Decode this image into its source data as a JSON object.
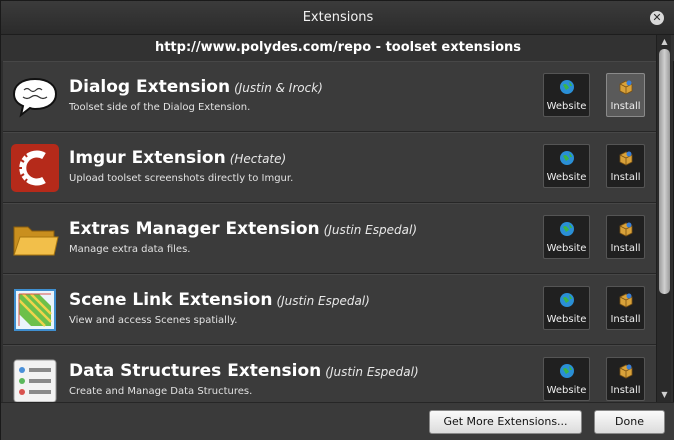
{
  "window": {
    "title": "Extensions"
  },
  "repo": {
    "header": "http://www.polydes.com/repo - toolset extensions"
  },
  "extensions": [
    {
      "name": "Dialog Extension",
      "author": "(Justin & Irock)",
      "description": "Toolset side of the Dialog Extension.",
      "icon": "speech-bubble-icon",
      "website_label": "Website",
      "install_label": "Install"
    },
    {
      "name": "Imgur Extension",
      "author": "(Hectate)",
      "description": "Upload toolset screenshots directly to Imgur.",
      "icon": "imgur-logo-icon",
      "website_label": "Website",
      "install_label": "Install"
    },
    {
      "name": "Extras Manager Extension",
      "author": "(Justin Espedal)",
      "description": "Manage extra data files.",
      "icon": "folder-icon",
      "website_label": "Website",
      "install_label": "Install"
    },
    {
      "name": "Scene Link Extension",
      "author": "(Justin Espedal)",
      "description": "View and access Scenes spatially.",
      "icon": "map-icon",
      "website_label": "Website",
      "install_label": "Install"
    },
    {
      "name": "Data Structures Extension",
      "author": "(Justin Espedal)",
      "description": "Create and Manage Data Structures.",
      "icon": "list-icon",
      "website_label": "Website",
      "install_label": "Install"
    }
  ],
  "footer": {
    "more_label": "Get More Extensions...",
    "done_label": "Done"
  },
  "colors": {
    "background": "#2f2f2f",
    "row": "#3b3b3b",
    "tile": "#202020",
    "accent_red": "#b52a1a"
  }
}
